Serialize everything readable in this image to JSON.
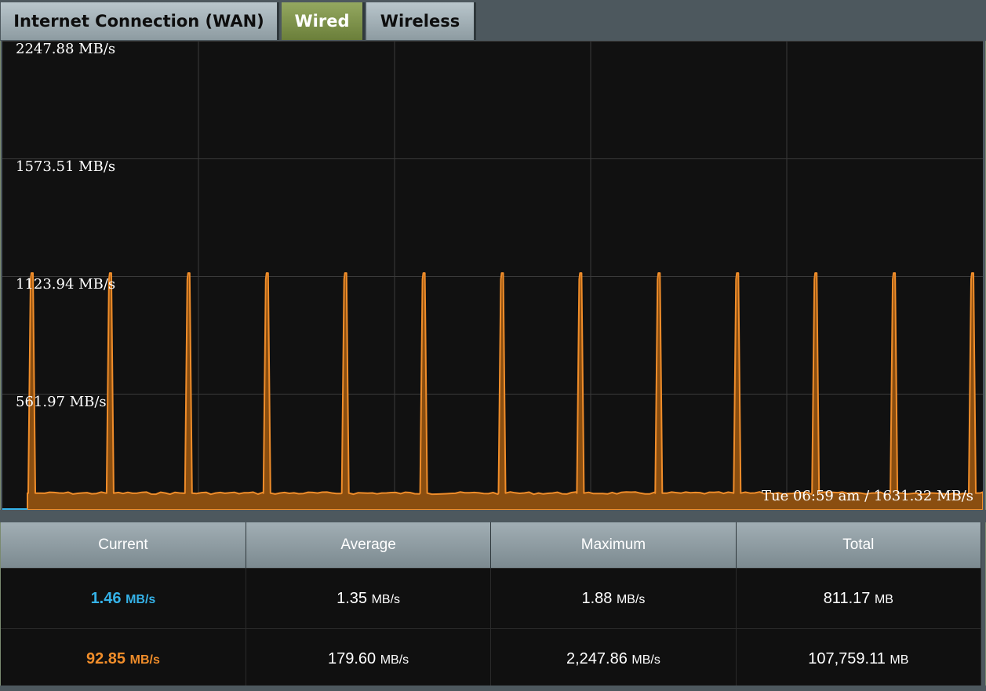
{
  "tabs": [
    {
      "label": "Internet Connection (WAN)",
      "active": false
    },
    {
      "label": "Wired",
      "active": true
    },
    {
      "label": "Wireless",
      "active": false
    }
  ],
  "chart": {
    "y_labels": [
      "2247.88 MB/s",
      "1573.51 MB/s",
      "1123.94 MB/s",
      "561.97 MB/s"
    ],
    "tooltip": "Tue 06:59 am / 1631.32 MB/s",
    "colors": {
      "fill": "#8a4e10",
      "line": "#f08d2a",
      "grid": "#3a3a3a",
      "bg": "#111111"
    }
  },
  "chart_data": {
    "type": "area",
    "ylim": [
      0,
      2247.88
    ],
    "y_ticks": [
      2247.88,
      1573.51,
      1123.94,
      561.97
    ],
    "baseline": 80,
    "spike_value": 1135,
    "spike_count": 13,
    "grid": true
  },
  "stats": {
    "headers": [
      "Current",
      "Average",
      "Maximum",
      "Total"
    ],
    "rows": [
      {
        "current": "1.46",
        "current_unit": "MB/s",
        "average": "1.35",
        "average_unit": "MB/s",
        "maximum": "1.88",
        "maximum_unit": "MB/s",
        "total": "811.17",
        "total_unit": "MB"
      },
      {
        "current": "92.85",
        "current_unit": "MB/s",
        "average": "179.60",
        "average_unit": "MB/s",
        "maximum": "2,247.86",
        "maximum_unit": "MB/s",
        "total": "107,759.11",
        "total_unit": "MB"
      }
    ],
    "colors": {
      "rx": "#35b2e8",
      "tx": "#f08d2a"
    }
  }
}
